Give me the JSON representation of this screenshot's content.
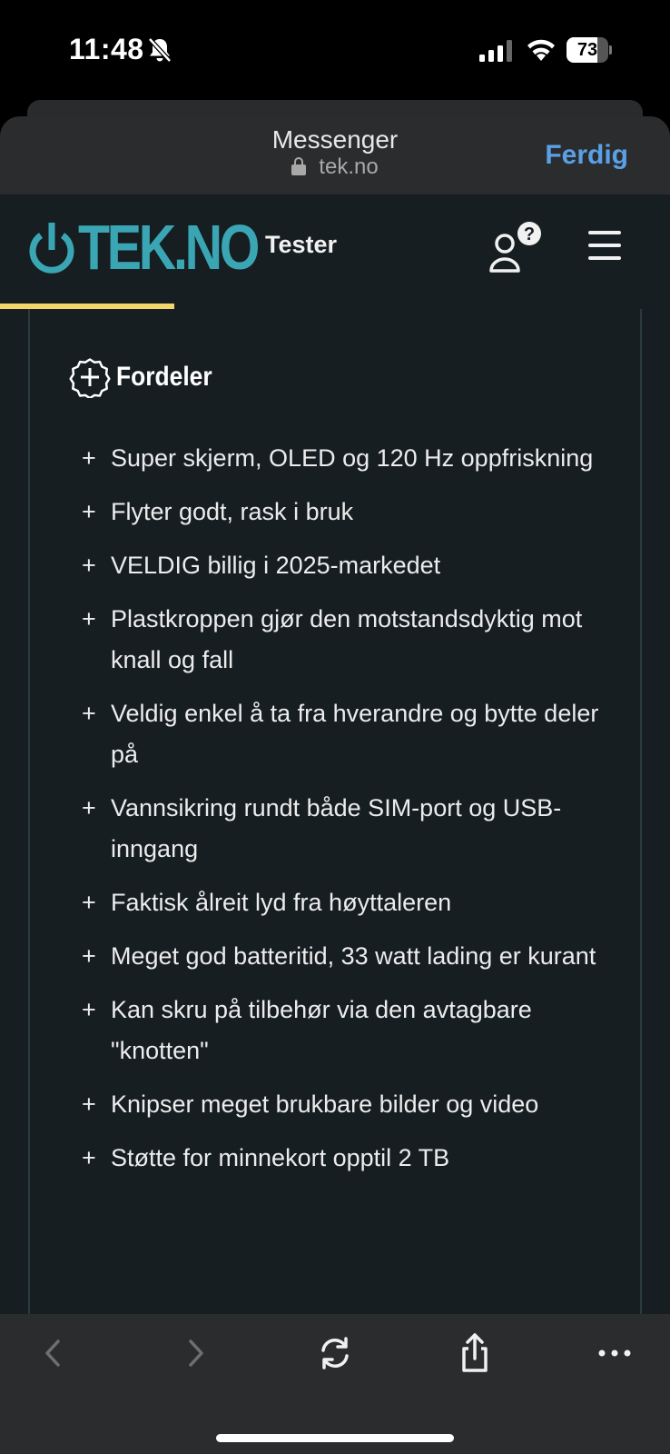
{
  "status_bar": {
    "time": "11:48",
    "battery_level": "73",
    "battery_fraction": 0.73,
    "icons": [
      "bell-slash-icon",
      "cellular-signal-icon",
      "wifi-icon",
      "battery-icon"
    ]
  },
  "sheet": {
    "title": "Messenger",
    "url": "tek.no",
    "done_label": "Ferdig",
    "accent_color": "#5aa0e6"
  },
  "site": {
    "logo_text": "TEK.NO",
    "logo_color": "#3aa6b4",
    "nav_label": "Tester",
    "underline_color": "#f2d66a",
    "icons": [
      "power-icon",
      "user-help-icon",
      "hamburger-menu-icon"
    ]
  },
  "pros": {
    "heading": "Fordeler",
    "bullet": "+",
    "items": [
      "Super skjerm, OLED og 120 Hz oppfriskning",
      "Flyter godt, rask i bruk",
      "VELDIG billig i 2025-markedet",
      "Plastkroppen gjør den motstandsdyktig mot knall og fall",
      "Veldig enkel å ta fra hverandre og bytte deler på",
      "Vannsikring rundt både SIM-port og USB-inngang",
      "Faktisk ålreit lyd fra høyttaleren",
      "Meget god batteritid, 33 watt lading er kurant",
      "Kan skru på tilbehør via den avtagbare \"knotten\"",
      "Knipser meget brukbare bilder og video",
      "Støtte for minnekort opptil 2 TB"
    ]
  },
  "toolbar": {
    "icons": [
      "back-icon",
      "forward-icon",
      "reload-icon",
      "share-icon",
      "more-icon"
    ]
  }
}
